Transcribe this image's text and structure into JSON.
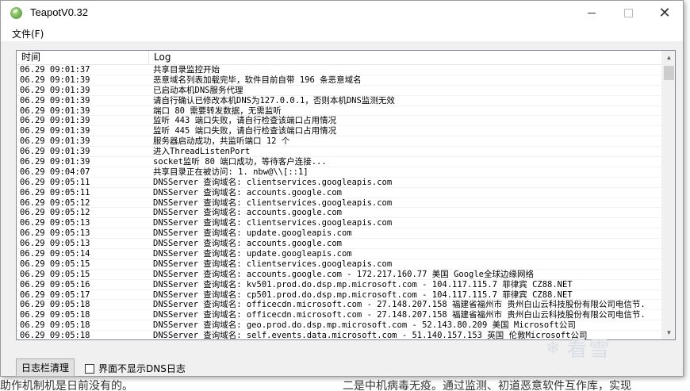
{
  "window": {
    "title": "TeapotV0.32",
    "close_glyph": "✕"
  },
  "menu": {
    "file": "文件(F)"
  },
  "log_table": {
    "columns": [
      "时间",
      "Log"
    ],
    "rows": [
      {
        "time": "06.29 09:01:37",
        "log": "共享目录监控开始"
      },
      {
        "time": "06.29 09:01:39",
        "log": "恶意域名列表加载完毕，软件目前自带 196 条恶意域名"
      },
      {
        "time": "06.29 09:01:39",
        "log": "已启动本机DNS服务代理"
      },
      {
        "time": "06.29 09:01:39",
        "log": "请自行确认已修改本机DNS为127.0.0.1，否则本机DNS监测无效"
      },
      {
        "time": "06.29 09:01:39",
        "log": "端口 80 需要转发数据，无需监听"
      },
      {
        "time": "06.29 09:01:39",
        "log": "监听 443 端口失败，请自行检查该端口占用情况"
      },
      {
        "time": "06.29 09:01:39",
        "log": "监听 445 端口失败，请自行检查该端口占用情况"
      },
      {
        "time": "06.29 09:01:39",
        "log": "服务器启动成功，共监听端口 12 个"
      },
      {
        "time": "06.29 09:01:39",
        "log": "进入ThreadListenPort"
      },
      {
        "time": "06.29 09:01:39",
        "log": "socket监听 80 端口成功，等待客户连接..."
      },
      {
        "time": "06.29 09:04:07",
        "log": "共享目录正在被访问: 1. nbw@\\\\[::1]"
      },
      {
        "time": "06.29 09:05:11",
        "log": "DNSServer 查询域名: clientservices.googleapis.com"
      },
      {
        "time": "06.29 09:05:11",
        "log": "DNSServer 查询域名: accounts.google.com"
      },
      {
        "time": "06.29 09:05:12",
        "log": "DNSServer 查询域名: clientservices.googleapis.com"
      },
      {
        "time": "06.29 09:05:12",
        "log": "DNSServer 查询域名: accounts.google.com"
      },
      {
        "time": "06.29 09:05:13",
        "log": "DNSServer 查询域名: clientservices.googleapis.com"
      },
      {
        "time": "06.29 09:05:13",
        "log": "DNSServer 查询域名: update.googleapis.com"
      },
      {
        "time": "06.29 09:05:13",
        "log": "DNSServer 查询域名: accounts.google.com"
      },
      {
        "time": "06.29 09:05:14",
        "log": "DNSServer 查询域名: update.googleapis.com"
      },
      {
        "time": "06.29 09:05:15",
        "log": "DNSServer 查询域名: clientservices.googleapis.com"
      },
      {
        "time": "06.29 09:05:15",
        "log": "DNSServer 查询域名: accounts.google.com - 172.217.160.77 美国 Google全球边缘网络"
      },
      {
        "time": "06.29 09:05:16",
        "log": "DNSServer 查询域名: kv501.prod.do.dsp.mp.microsoft.com - 104.117.115.7 菲律宾  CZ88.NET"
      },
      {
        "time": "06.29 09:05:17",
        "log": "DNSServer 查询域名: cp501.prod.do.dsp.mp.microsoft.com - 104.117.115.7 菲律宾  CZ88.NET"
      },
      {
        "time": "06.29 09:05:18",
        "log": "DNSServer 查询域名: officecdn.microsoft.com - 27.148.207.158 福建省福州市 贵州白山云科技股份有限公司电信节."
      },
      {
        "time": "06.29 09:05:18",
        "log": "DNSServer 查询域名: officecdn.microsoft.com - 27.148.207.158 福建省福州市 贵州白山云科技股份有限公司电信节."
      },
      {
        "time": "06.29 09:05:18",
        "log": "DNSServer 查询域名: geo.prod.do.dsp.mp.microsoft.com - 52.143.80.209 美国 Microsoft公司"
      },
      {
        "time": "06.29 09:05:18",
        "log": "DNSServer 查询域名: self.events.data.microsoft.com - 51.140.157.153 英国 伦敦Microsoft公司"
      }
    ]
  },
  "controls": {
    "clear_button": "日志栏清理",
    "hide_dns_checkbox": "界面不显示DNS日志",
    "hide_dns_checked": false
  },
  "watermark": {
    "text": "看雪"
  },
  "background_page": {
    "bottom_text_left": "助作机制机是日前没有的。",
    "bottom_text_right": "二是中机病毒无疫。通过监测、初道恶意软件互作库，实现"
  }
}
